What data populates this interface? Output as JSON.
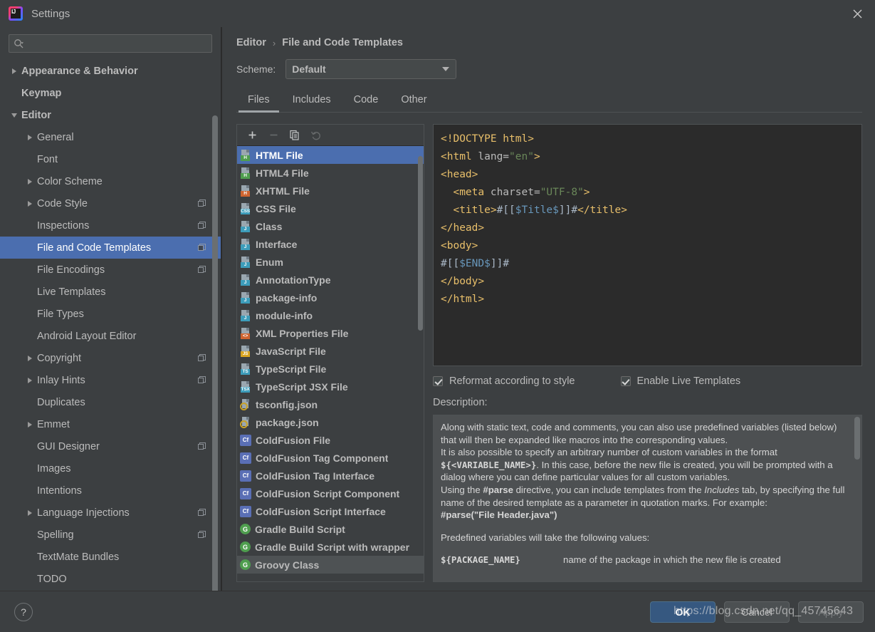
{
  "window": {
    "title": "Settings",
    "logo_icon": "intellij-idea-logo",
    "close_icon": "close-icon"
  },
  "sidebar": {
    "search": {
      "placeholder": "",
      "value": "",
      "icon": "search-icon"
    },
    "items": [
      {
        "label": "Appearance & Behavior",
        "arrow": "right",
        "indent": 0,
        "bold": true,
        "selected": false,
        "badge": false
      },
      {
        "label": "Keymap",
        "arrow": "none",
        "indent": 0,
        "bold": true,
        "selected": false,
        "badge": false
      },
      {
        "label": "Editor",
        "arrow": "down",
        "indent": 0,
        "bold": true,
        "selected": false,
        "badge": false
      },
      {
        "label": "General",
        "arrow": "right",
        "indent": 1,
        "bold": false,
        "selected": false,
        "badge": false
      },
      {
        "label": "Font",
        "arrow": "none",
        "indent": 1,
        "bold": false,
        "selected": false,
        "badge": false
      },
      {
        "label": "Color Scheme",
        "arrow": "right",
        "indent": 1,
        "bold": false,
        "selected": false,
        "badge": false
      },
      {
        "label": "Code Style",
        "arrow": "right",
        "indent": 1,
        "bold": false,
        "selected": false,
        "badge": true
      },
      {
        "label": "Inspections",
        "arrow": "none",
        "indent": 1,
        "bold": false,
        "selected": false,
        "badge": true
      },
      {
        "label": "File and Code Templates",
        "arrow": "none",
        "indent": 1,
        "bold": false,
        "selected": true,
        "badge": true
      },
      {
        "label": "File Encodings",
        "arrow": "none",
        "indent": 1,
        "bold": false,
        "selected": false,
        "badge": true
      },
      {
        "label": "Live Templates",
        "arrow": "none",
        "indent": 1,
        "bold": false,
        "selected": false,
        "badge": false
      },
      {
        "label": "File Types",
        "arrow": "none",
        "indent": 1,
        "bold": false,
        "selected": false,
        "badge": false
      },
      {
        "label": "Android Layout Editor",
        "arrow": "none",
        "indent": 1,
        "bold": false,
        "selected": false,
        "badge": false
      },
      {
        "label": "Copyright",
        "arrow": "right",
        "indent": 1,
        "bold": false,
        "selected": false,
        "badge": true
      },
      {
        "label": "Inlay Hints",
        "arrow": "right",
        "indent": 1,
        "bold": false,
        "selected": false,
        "badge": true
      },
      {
        "label": "Duplicates",
        "arrow": "none",
        "indent": 1,
        "bold": false,
        "selected": false,
        "badge": false
      },
      {
        "label": "Emmet",
        "arrow": "right",
        "indent": 1,
        "bold": false,
        "selected": false,
        "badge": false
      },
      {
        "label": "GUI Designer",
        "arrow": "none",
        "indent": 1,
        "bold": false,
        "selected": false,
        "badge": true
      },
      {
        "label": "Images",
        "arrow": "none",
        "indent": 1,
        "bold": false,
        "selected": false,
        "badge": false
      },
      {
        "label": "Intentions",
        "arrow": "none",
        "indent": 1,
        "bold": false,
        "selected": false,
        "badge": false
      },
      {
        "label": "Language Injections",
        "arrow": "right",
        "indent": 1,
        "bold": false,
        "selected": false,
        "badge": true
      },
      {
        "label": "Spelling",
        "arrow": "none",
        "indent": 1,
        "bold": false,
        "selected": false,
        "badge": true
      },
      {
        "label": "TextMate Bundles",
        "arrow": "none",
        "indent": 1,
        "bold": false,
        "selected": false,
        "badge": false
      },
      {
        "label": "TODO",
        "arrow": "none",
        "indent": 1,
        "bold": false,
        "selected": false,
        "badge": false
      }
    ]
  },
  "content": {
    "breadcrumb": {
      "parent": "Editor",
      "separator": "›",
      "current": "File and Code Templates"
    },
    "scheme": {
      "label": "Scheme:",
      "value": "Default",
      "caret_icon": "chevron-down-icon"
    },
    "tabs": [
      {
        "label": "Files",
        "active": true
      },
      {
        "label": "Includes",
        "active": false
      },
      {
        "label": "Code",
        "active": false
      },
      {
        "label": "Other",
        "active": false
      }
    ],
    "list_toolbar": [
      {
        "name": "add-template-button",
        "glyph": "+",
        "icon": "plus-icon",
        "disabled": false
      },
      {
        "name": "remove-template-button",
        "glyph": "−",
        "icon": "minus-icon",
        "disabled": true
      },
      {
        "name": "copy-template-button",
        "glyph": "copy",
        "icon": "copy-icon",
        "disabled": false
      },
      {
        "name": "reset-template-button",
        "glyph": "reset",
        "icon": "undo-arrow-icon",
        "disabled": true
      }
    ],
    "templates": [
      {
        "label": "HTML File",
        "icon": "html-file-icon",
        "icon_kind": "page",
        "tag": "H",
        "tag_color": "#4f9e4f",
        "selected": true
      },
      {
        "label": "HTML4 File",
        "icon": "html4-file-icon",
        "icon_kind": "page",
        "tag": "H",
        "tag_color": "#4f9e4f",
        "selected": false
      },
      {
        "label": "XHTML File",
        "icon": "xhtml-file-icon",
        "icon_kind": "page",
        "tag": "H",
        "tag_color": "#cf6430",
        "selected": false
      },
      {
        "label": "CSS File",
        "icon": "css-file-icon",
        "icon_kind": "page",
        "tag": "CSS",
        "tag_color": "#3d9dbb",
        "selected": false
      },
      {
        "label": "Class",
        "icon": "java-class-icon",
        "icon_kind": "page",
        "tag": "J",
        "tag_color": "#3d9dbb",
        "selected": false
      },
      {
        "label": "Interface",
        "icon": "java-interface-icon",
        "icon_kind": "page",
        "tag": "J",
        "tag_color": "#3d9dbb",
        "selected": false
      },
      {
        "label": "Enum",
        "icon": "java-enum-icon",
        "icon_kind": "page",
        "tag": "J",
        "tag_color": "#3d9dbb",
        "selected": false
      },
      {
        "label": "AnnotationType",
        "icon": "java-annotation-icon",
        "icon_kind": "page",
        "tag": "J",
        "tag_color": "#3d9dbb",
        "selected": false
      },
      {
        "label": "package-info",
        "icon": "java-package-info-icon",
        "icon_kind": "page",
        "tag": "J",
        "tag_color": "#3d9dbb",
        "selected": false
      },
      {
        "label": "module-info",
        "icon": "java-module-info-icon",
        "icon_kind": "page",
        "tag": "J",
        "tag_color": "#3d9dbb",
        "selected": false
      },
      {
        "label": "XML Properties File",
        "icon": "xml-properties-icon",
        "icon_kind": "page",
        "tag": "<>",
        "tag_color": "#cf6430",
        "selected": false
      },
      {
        "label": "JavaScript File",
        "icon": "javascript-file-icon",
        "icon_kind": "page",
        "tag": "JS",
        "tag_color": "#d9a420",
        "selected": false
      },
      {
        "label": "TypeScript File",
        "icon": "typescript-file-icon",
        "icon_kind": "page",
        "tag": "TS",
        "tag_color": "#3d9dbb",
        "selected": false
      },
      {
        "label": "TypeScript JSX File",
        "icon": "typescript-jsx-icon",
        "icon_kind": "page",
        "tag": "TSX",
        "tag_color": "#3d9dbb",
        "selected": false
      },
      {
        "label": "tsconfig.json",
        "icon": "json-file-icon",
        "icon_kind": "json",
        "tag": "",
        "tag_color": "#c9a227",
        "selected": false
      },
      {
        "label": "package.json",
        "icon": "json-file-icon",
        "icon_kind": "json",
        "tag": "",
        "tag_color": "#c9a227",
        "selected": false
      },
      {
        "label": "ColdFusion File",
        "icon": "coldfusion-file-icon",
        "icon_kind": "square",
        "tag": "Cf",
        "tag_color": "#5a6fb5",
        "selected": false
      },
      {
        "label": "ColdFusion Tag Component",
        "icon": "coldfusion-file-icon",
        "icon_kind": "square",
        "tag": "Cf",
        "tag_color": "#5a6fb5",
        "selected": false
      },
      {
        "label": "ColdFusion Tag Interface",
        "icon": "coldfusion-file-icon",
        "icon_kind": "square",
        "tag": "Cf",
        "tag_color": "#5a6fb5",
        "selected": false
      },
      {
        "label": "ColdFusion Script Component",
        "icon": "coldfusion-file-icon",
        "icon_kind": "square",
        "tag": "Cf",
        "tag_color": "#5a6fb5",
        "selected": false
      },
      {
        "label": "ColdFusion Script Interface",
        "icon": "coldfusion-file-icon",
        "icon_kind": "square",
        "tag": "Cf",
        "tag_color": "#5a6fb5",
        "selected": false
      },
      {
        "label": "Gradle Build Script",
        "icon": "groovy-file-icon",
        "icon_kind": "circle",
        "tag": "G",
        "tag_color": "#4f9e4f",
        "selected": false
      },
      {
        "label": "Gradle Build Script with wrapper",
        "icon": "groovy-file-icon",
        "icon_kind": "circle",
        "tag": "G",
        "tag_color": "#4f9e4f",
        "selected": false
      },
      {
        "label": "Groovy Class",
        "icon": "groovy-file-icon",
        "icon_kind": "circle",
        "tag": "G",
        "tag_color": "#4f9e4f",
        "selected": false,
        "hover": true
      }
    ],
    "editor": {
      "lines": [
        [
          {
            "t": "<!DOCTYPE html>",
            "c": "tag"
          }
        ],
        [
          {
            "t": "<html ",
            "c": "tag"
          },
          {
            "t": "lang=",
            "c": "attr"
          },
          {
            "t": "\"en\"",
            "c": "val"
          },
          {
            "t": ">",
            "c": "tag"
          }
        ],
        [
          {
            "t": "<head>",
            "c": "tag"
          }
        ],
        [
          {
            "t": "  <meta ",
            "c": "tag"
          },
          {
            "t": "charset=",
            "c": "attr"
          },
          {
            "t": "\"UTF-8\"",
            "c": "val"
          },
          {
            "t": ">",
            "c": "tag"
          }
        ],
        [
          {
            "t": "  <title>",
            "c": "tag"
          },
          {
            "t": "#[[",
            "c": "txt"
          },
          {
            "t": "$Title$",
            "c": "var"
          },
          {
            "t": "]]#",
            "c": "txt"
          },
          {
            "t": "</title>",
            "c": "tag"
          }
        ],
        [
          {
            "t": "</head>",
            "c": "tag"
          }
        ],
        [
          {
            "t": "<body>",
            "c": "tag"
          }
        ],
        [
          {
            "t": "#[[",
            "c": "txt"
          },
          {
            "t": "$END$",
            "c": "var"
          },
          {
            "t": "]]#",
            "c": "txt"
          }
        ],
        [
          {
            "t": "</body>",
            "c": "tag"
          }
        ],
        [
          {
            "t": "</html>",
            "c": "tag"
          }
        ]
      ]
    },
    "checkboxes": [
      {
        "label": "Reformat according to style",
        "checked": true
      },
      {
        "label": "Enable Live Templates",
        "checked": true
      }
    ],
    "description_label": "Description:",
    "description": {
      "p1": "Along with static text, code and comments, you can also use predefined variables (listed below) that will then be expanded like macros into the corresponding values.",
      "p2_a": "It is also possible to specify an arbitrary number of custom variables in the format ",
      "p2_b": "${<VARIABLE_NAME>}",
      "p2_c": ". In this case, before the new file is created, you will be prompted with a dialog where you can define particular values for all custom variables.",
      "p3_a": "Using the ",
      "p3_b": "#parse",
      "p3_c": " directive, you can include templates from the ",
      "p3_d": "Includes",
      "p3_e": " tab, by specifying the full name of the desired template as a parameter in quotation marks. For example:",
      "p4": "#parse(\"File Header.java\")",
      "p5": "Predefined variables will take the following values:",
      "var_name": "${PACKAGE_NAME}",
      "var_desc": "name of the package in which the new file is created"
    }
  },
  "footer": {
    "help_label": "?",
    "help_icon": "question-mark-icon",
    "ok": "OK",
    "cancel": "Cancel",
    "apply": "Apply"
  },
  "overlay": {
    "watermark": "https://blog.csdn.net/qq_45745643"
  },
  "colors": {
    "accent": "#4b6eaf",
    "primary_button": "#365880",
    "panel_bg": "#3c3f41",
    "editor_bg": "#2b2b2b",
    "desc_bg": "#4d5052",
    "text": "#bbbbbb"
  }
}
